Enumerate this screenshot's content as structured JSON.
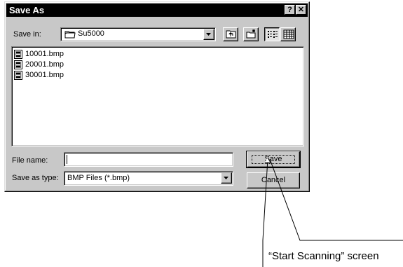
{
  "window": {
    "title": "Save As",
    "help_glyph": "?",
    "close_glyph": "✕"
  },
  "save_in": {
    "label": "Save in:",
    "folder": "Su5000",
    "folder_icon": "folder-icon"
  },
  "toolbar": {
    "up_icon": "up-one-level-icon",
    "new_folder_icon": "new-folder-icon",
    "list_icon": "list-view-icon",
    "details_icon": "details-view-icon"
  },
  "files": [
    {
      "name": "10001.bmp",
      "icon": "bitmap-file-icon"
    },
    {
      "name": "20001.bmp",
      "icon": "bitmap-file-icon"
    },
    {
      "name": "30001.bmp",
      "icon": "bitmap-file-icon"
    }
  ],
  "file_name": {
    "label": "File name:",
    "value": ""
  },
  "save_as_type": {
    "label": "Save as type:",
    "value": "BMP Files (*.bmp)"
  },
  "buttons": {
    "save": "Save",
    "cancel": "Cancel"
  },
  "annotation": {
    "text": "“Start Scanning” screen"
  }
}
